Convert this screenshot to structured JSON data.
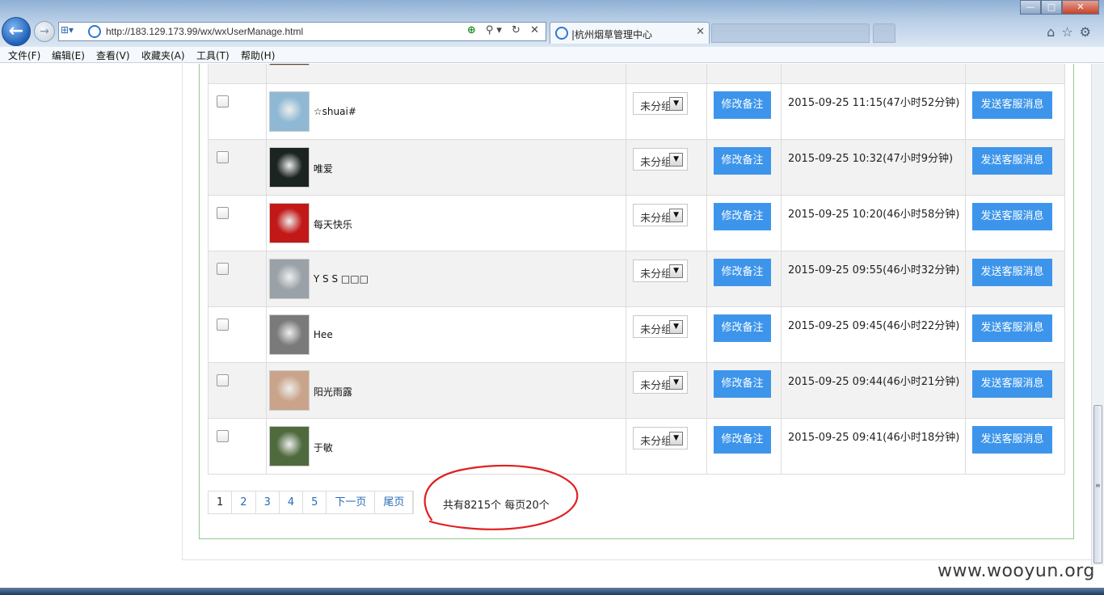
{
  "browser": {
    "url": "http://183.129.173.99/wx/wxUserManage.html",
    "active_tab_title": "|杭州烟草管理中心",
    "menu": [
      "文件(F)",
      "编辑(E)",
      "查看(V)",
      "收藏夹(A)",
      "工具(T)",
      "帮助(H)"
    ]
  },
  "table": {
    "group_default": "未分组",
    "edit_button_label": "修改备注",
    "send_button_label": "发送客服消息",
    "rows": [
      {
        "name": "☆shuai#",
        "time": "2015-09-25 11:15(47小时52分钟)",
        "avatar_color": "#8fb8d4"
      },
      {
        "name": "唯爱",
        "time": "2015-09-25 10:32(47小时9分钟)",
        "avatar_color": "#1b2420"
      },
      {
        "name": "每天快乐",
        "time": "2015-09-25 10:20(46小时58分钟)",
        "avatar_color": "#c21818"
      },
      {
        "name": "Y S S □□□",
        "time": "2015-09-25 09:55(46小时32分钟)",
        "avatar_color": "#9aa2a8"
      },
      {
        "name": "Hee",
        "time": "2015-09-25 09:45(46小时22分钟)",
        "avatar_color": "#7a7a7a"
      },
      {
        "name": "阳光雨露",
        "time": "2015-09-25 09:44(46小时21分钟)",
        "avatar_color": "#c9a48a"
      },
      {
        "name": "于敏",
        "time": "2015-09-25 09:41(46小时18分钟)",
        "avatar_color": "#4f6b3e"
      }
    ]
  },
  "pagination": {
    "pages": [
      "1",
      "2",
      "3",
      "4",
      "5"
    ],
    "next_label": "下一页",
    "last_label": "尾页",
    "total_text": "共有8215个 每页20个"
  },
  "watermark": "www.wooyun.org",
  "colors": {
    "button_blue": "#3d95eb",
    "panel_border": "#8fcb8f",
    "link_blue": "#2a6bb6",
    "annotation_red": "#e02020"
  }
}
